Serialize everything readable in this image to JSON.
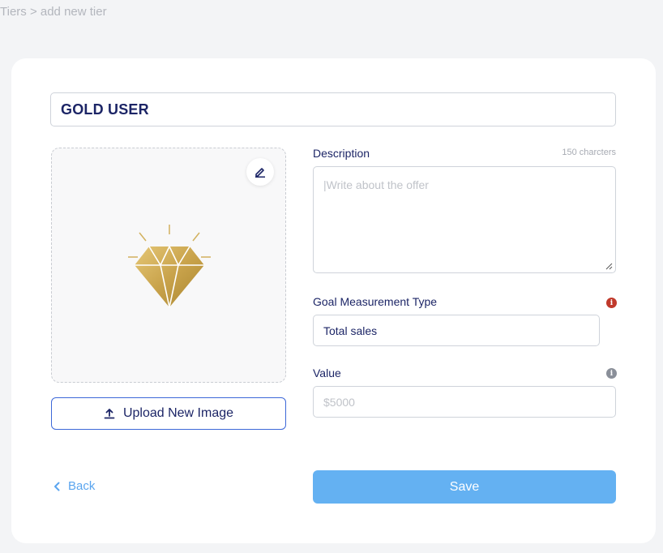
{
  "breadcrumb": "Tiers > add new tier",
  "tier": {
    "name": "GOLD USER"
  },
  "image_panel": {
    "upload_label": "Upload New Image",
    "edit_icon": "pencil-icon",
    "image_icon": "diamond-icon"
  },
  "description": {
    "label": "Description",
    "counter": "150 charcters",
    "placeholder": "|Write about the offer"
  },
  "goal": {
    "label": "Goal Measurement Type",
    "value": "Total sales",
    "info_color": "#c0392b"
  },
  "value_field": {
    "label": "Value",
    "placeholder": "$5000",
    "info_color": "#8a8f99"
  },
  "actions": {
    "back_label": "Back",
    "save_label": "Save"
  },
  "colors": {
    "accent": "#64b1f2",
    "border_blue": "#3d68d8",
    "text_dark": "#1c2566",
    "gold": "#c9a34b"
  }
}
